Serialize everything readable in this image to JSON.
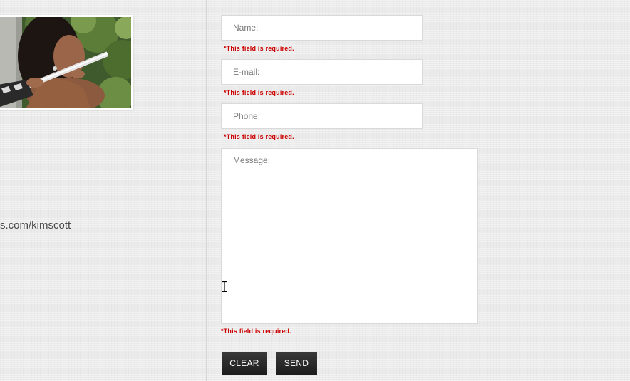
{
  "profile": {
    "link_text": "s.com/kimscott"
  },
  "form": {
    "name_placeholder": "Name:",
    "email_placeholder": "E-mail:",
    "phone_placeholder": "Phone:",
    "message_placeholder": "Message:",
    "required_error": "*This field is required.",
    "clear_label": "CLEAR",
    "send_label": "SEND"
  },
  "icons": {
    "text_cursor": "i-beam-cursor-icon"
  },
  "colors": {
    "error": "#cc0000",
    "button_bg": "#222222",
    "button_text": "#ffffff",
    "page_bg": "#ebebeb"
  }
}
